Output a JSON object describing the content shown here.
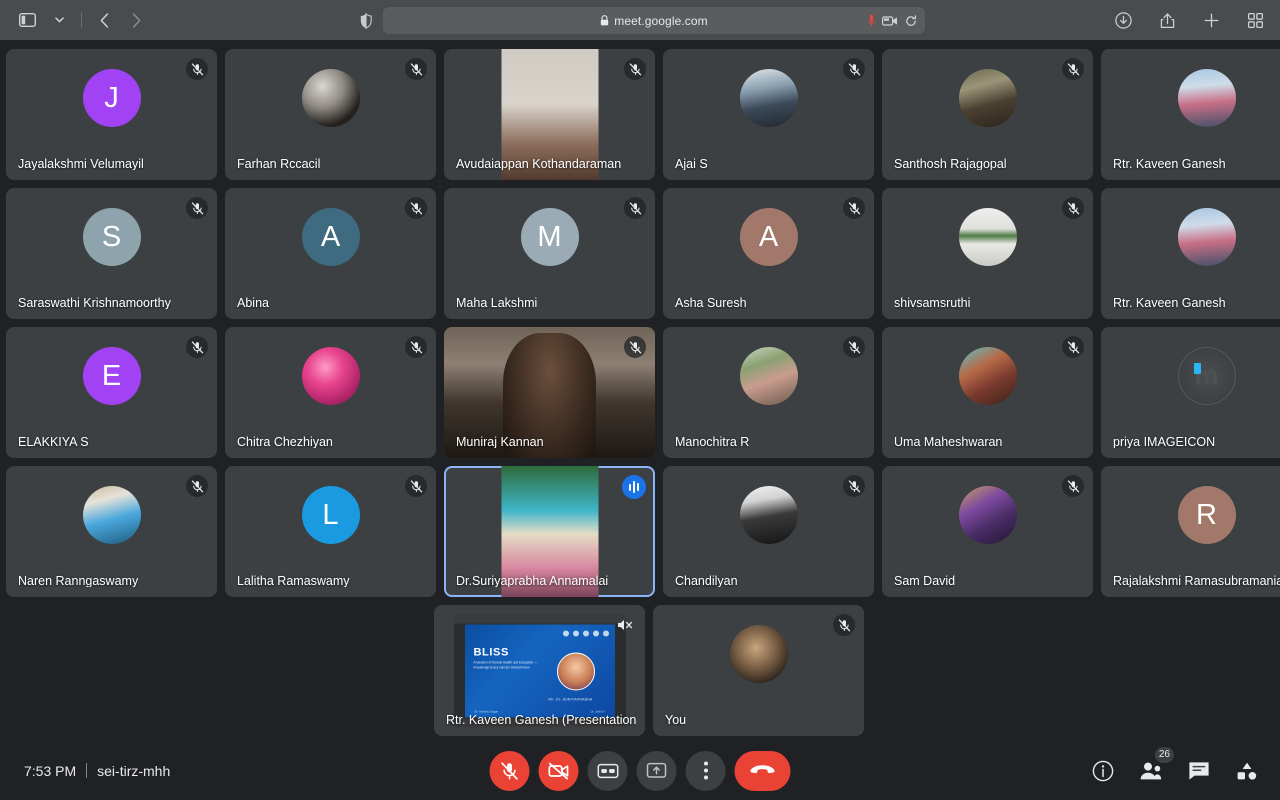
{
  "browser": {
    "url": "meet.google.com",
    "lock_icon": "lock-icon",
    "sidebar_icon": "sidebar-toggle-icon",
    "back_icon": "back-arrow-icon",
    "forward_icon": "forward-arrow-icon",
    "shield_icon": "privacy-shield-icon",
    "mic_active_icon": "microphone-active-icon",
    "camera_active_icon": "camera-active-icon",
    "reload_icon": "reload-icon",
    "downloads_icon": "downloads-icon",
    "share_icon": "share-icon",
    "new_tab_icon": "plus-icon",
    "tab_overview_icon": "tab-overview-icon"
  },
  "meeting": {
    "time": "7:53 PM",
    "code": "sei-tirz-mhh",
    "participant_count": "26",
    "accent_blue": "#1a73e8",
    "active_border": "#8ab4f8",
    "danger_red": "#ea4335",
    "tile_bg": "#3c4043",
    "stage_bg": "#202124"
  },
  "controls": {
    "mic": {
      "label": "Turn on microphone",
      "icon": "microphone-off-icon",
      "state": "muted"
    },
    "camera": {
      "label": "Turn on camera",
      "icon": "camera-off-icon",
      "state": "off"
    },
    "captions": {
      "label": "Turn on captions",
      "icon": "closed-captions-icon"
    },
    "present": {
      "label": "Present now",
      "icon": "present-screen-icon"
    },
    "more": {
      "label": "More options",
      "icon": "more-vertical-icon"
    },
    "leave": {
      "label": "Leave call",
      "icon": "end-call-icon"
    }
  },
  "right_controls": {
    "info": {
      "label": "Meeting details",
      "icon": "info-icon"
    },
    "people": {
      "label": "People",
      "icon": "people-icon",
      "badge": "26"
    },
    "chat": {
      "label": "Chat with everyone",
      "icon": "chat-icon"
    },
    "activities": {
      "label": "Activities",
      "icon": "activities-icon"
    }
  },
  "tiles": [
    [
      {
        "name": "Jayalakshmi Velumayil",
        "kind": "initial",
        "initial": "J",
        "color": "#a142f4",
        "muted": true
      },
      {
        "name": "Farhan Rccacil",
        "kind": "photo",
        "photo": "two-men-award",
        "muted": true
      },
      {
        "name": "Avudaiappan Kothandaraman",
        "kind": "video",
        "video": "portrait-room",
        "muted": true
      },
      {
        "name": "Ajai S",
        "kind": "photo",
        "photo": "man-blue-shirt",
        "muted": true
      },
      {
        "name": "Santhosh Rajagopal",
        "kind": "photo",
        "photo": "man-glasses",
        "muted": true
      },
      {
        "name": "Rtr. Kaveen Ganesh",
        "kind": "photo",
        "photo": "man-pink-shirt",
        "muted": true
      }
    ],
    [
      {
        "name": "Saraswathi Krishnamoorthy",
        "kind": "initial",
        "initial": "S",
        "color": "#8fa3ad",
        "muted": true
      },
      {
        "name": "Abina",
        "kind": "initial",
        "initial": "A",
        "color": "#3f6b80",
        "muted": true
      },
      {
        "name": "Maha Lakshmi",
        "kind": "initial",
        "initial": "M",
        "color": "#9aabb5",
        "muted": true
      },
      {
        "name": "Asha Suresh",
        "kind": "initial",
        "initial": "A",
        "color": "#a1786a",
        "muted": true
      },
      {
        "name": "shivsamsruthi",
        "kind": "photo",
        "photo": "wall-painting",
        "muted": true
      },
      {
        "name": "Rtr. Kaveen Ganesh",
        "kind": "photo",
        "photo": "man-pink-shirt",
        "muted": true
      }
    ],
    [
      {
        "name": "ELAKKIYA S",
        "kind": "initial",
        "initial": "E",
        "color": "#a142f4",
        "muted": true
      },
      {
        "name": "Chitra Chezhiyan",
        "kind": "photo",
        "photo": "pink-blossoms",
        "muted": true
      },
      {
        "name": "Muniraj Kannan",
        "kind": "video",
        "video": "man-cafe-background",
        "muted": true
      },
      {
        "name": "Manochitra R",
        "kind": "photo",
        "photo": "woman-garden",
        "muted": true
      },
      {
        "name": "Uma Maheshwaran",
        "kind": "photo",
        "photo": "woman-ceremony",
        "muted": true
      },
      {
        "name": "priya IMAGEICON",
        "kind": "photo",
        "photo": "imageicon-logo",
        "muted": true
      }
    ],
    [
      {
        "name": "Naren Ranngaswamy",
        "kind": "photo",
        "photo": "man-light-blue",
        "muted": true
      },
      {
        "name": "Lalitha Ramaswamy",
        "kind": "initial",
        "initial": "L",
        "color": "#1a9ae0",
        "muted": true
      },
      {
        "name": "Dr.Suriyaprabha Annamalai",
        "kind": "video",
        "video": "woman-beach-background",
        "active": true,
        "speaking": true
      },
      {
        "name": "Chandilyan",
        "kind": "photo",
        "photo": "man-bw-portrait",
        "muted": true
      },
      {
        "name": "Sam David",
        "kind": "photo",
        "photo": "person-corridor",
        "muted": true
      },
      {
        "name": "Rajalakshmi Ramasubramanian",
        "kind": "initial",
        "initial": "R",
        "color": "#a1786a",
        "muted": true
      }
    ],
    [
      {
        "name": "Rtr. Kaveen Ganesh (Presentation)",
        "kind": "presentation",
        "speaker_muted": true,
        "slide": {
          "title": "BLISS",
          "subtitle": "A Session of Sexual Health and Education — Knowledge Every Gender Should Know",
          "presenter": "Rtr. Dr. SURIYAPRABHA",
          "footer_left": "Dr. Vandhu Sagar",
          "footer_right": "Dr. Jothi N"
        }
      },
      {
        "name": "You",
        "kind": "photo",
        "photo": "person-with-pet",
        "muted": true
      }
    ]
  ]
}
